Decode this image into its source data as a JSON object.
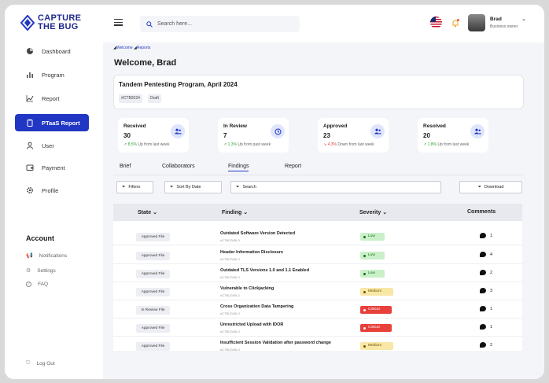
{
  "brand": {
    "line1": "CAPTURE",
    "line2": "THE BUG"
  },
  "sidebar": {
    "items": [
      {
        "label": "Dashboard",
        "icon": "pie-chart-icon"
      },
      {
        "label": "Program",
        "icon": "bar-chart-icon"
      },
      {
        "label": "Report",
        "icon": "line-chart-icon"
      },
      {
        "label": "PTaaS Report",
        "icon": "clipboard-icon",
        "active": true
      },
      {
        "label": "User",
        "icon": "user-icon"
      },
      {
        "label": "Payment",
        "icon": "wallet-icon"
      },
      {
        "label": "Profile",
        "icon": "gear-icon"
      }
    ],
    "account_title": "Account",
    "account_items": [
      {
        "label": "Notifications",
        "icon": "megaphone-icon"
      },
      {
        "label": "Settings",
        "icon": "gear-icon"
      },
      {
        "label": "FAQ",
        "icon": "question-icon"
      }
    ],
    "logout": "Log Out"
  },
  "topbar": {
    "search_placeholder": "Search here...",
    "user_name": "Brad",
    "user_role": "Business owner"
  },
  "breadcrumb": {
    "a": "Welcome",
    "b": "Reports"
  },
  "welcome": "Welcome, Brad",
  "program": {
    "title": "Tandem Pentesting Program, April 2024",
    "tags": [
      "#CTB2024",
      "Draft"
    ]
  },
  "stats": [
    {
      "label": "Received",
      "value": "30",
      "pct": "8.5%",
      "trend": "Up from last week",
      "dir": "up"
    },
    {
      "label": "In Review",
      "value": "7",
      "pct": "1.3%",
      "trend": "Up from past week",
      "dir": "up"
    },
    {
      "label": "Approved",
      "value": "23",
      "pct": "4.3%",
      "trend": "Down from last week",
      "dir": "down"
    },
    {
      "label": "Resolved",
      "value": "20",
      "pct": "1.8%",
      "trend": "Up from last week",
      "dir": "up"
    }
  ],
  "tabs": [
    "Brief",
    "Collaborators",
    "Findings",
    "Report"
  ],
  "controls": {
    "filters": "Filters",
    "sort": "Sort By Date",
    "search": "Search",
    "download": "Download"
  },
  "table": {
    "headers": {
      "state": "State",
      "finding": "Finding",
      "severity": "Severity",
      "comments": "Comments"
    },
    "rows": [
      {
        "state": "Approved File",
        "title": "Outdated Software Version Detected",
        "id": "#CTBI2345L3",
        "severity": "Low",
        "comments": "1"
      },
      {
        "state": "Approved File",
        "title": "Header Information Disclosure",
        "id": "#CTBI2345L3",
        "severity": "Low",
        "comments": "4"
      },
      {
        "state": "Approved File",
        "title": "Outdated TLS Versions 1.0 and 1.1 Enabled",
        "id": "#CTBI2345L3",
        "severity": "Low",
        "comments": "2"
      },
      {
        "state": "Approved File",
        "title": "Vulnerable to Clickjacking",
        "id": "#CTBI2345L3",
        "severity": "Medium",
        "comments": "3"
      },
      {
        "state": "In Review File",
        "title": "Cross Organization Data Tampering",
        "id": "#CTBI2345L3",
        "severity": "Critical",
        "comments": "1"
      },
      {
        "state": "Approved File",
        "title": " Unrestricted Upload with IDOR",
        "id": "#CTBI2345L3",
        "severity": "Critical",
        "comments": "1"
      },
      {
        "state": "Approved File",
        "title": "Insufficient Session Validation after password change",
        "id": "#CTBI2345L3",
        "severity": "Medium",
        "comments": "2"
      }
    ]
  },
  "colors": {
    "accent": "#2137c4",
    "brand": "#1f2a8c",
    "low": "#c9f0c9",
    "medium": "#f9e7a6",
    "critical": "#e8403a"
  }
}
